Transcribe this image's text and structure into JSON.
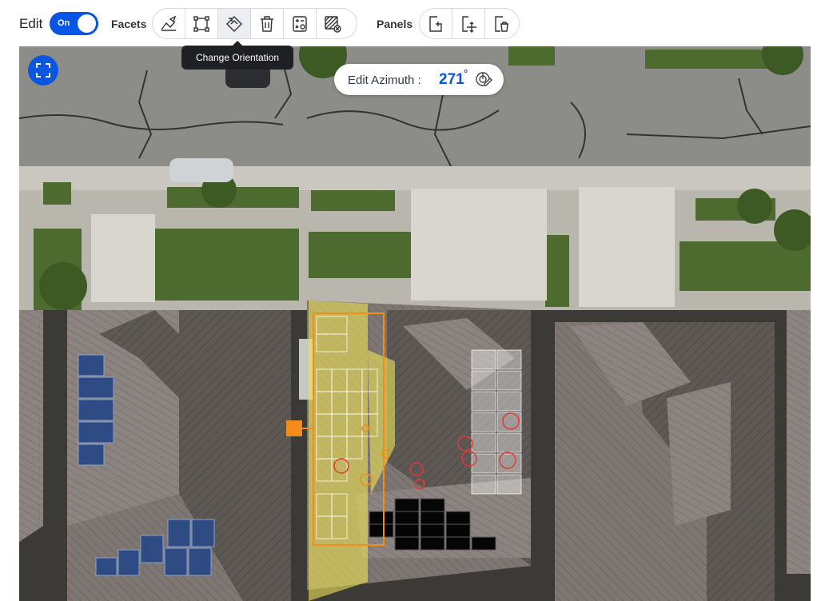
{
  "toolbar": {
    "edit_label": "Edit",
    "toggle_label": "On",
    "facets_label": "Facets",
    "panels_label": "Panels",
    "facet_tools": [
      "draw-facet-icon",
      "rectangle-facet-icon",
      "change-orientation-icon",
      "delete-icon",
      "calculator-icon",
      "clear-obstructions-icon"
    ],
    "panel_tools": [
      "add-panel-icon",
      "move-panel-icon",
      "delete-panel-icon"
    ],
    "tooltip": "Change Orientation"
  },
  "azimuth": {
    "label": "Edit Azimuth :",
    "value": "271",
    "unit": "°"
  },
  "colors": {
    "accent": "#0a55e6",
    "facet_outline": "#f28c1a",
    "facet_fill": "#f0e35a",
    "obstruction": "#e53935"
  }
}
